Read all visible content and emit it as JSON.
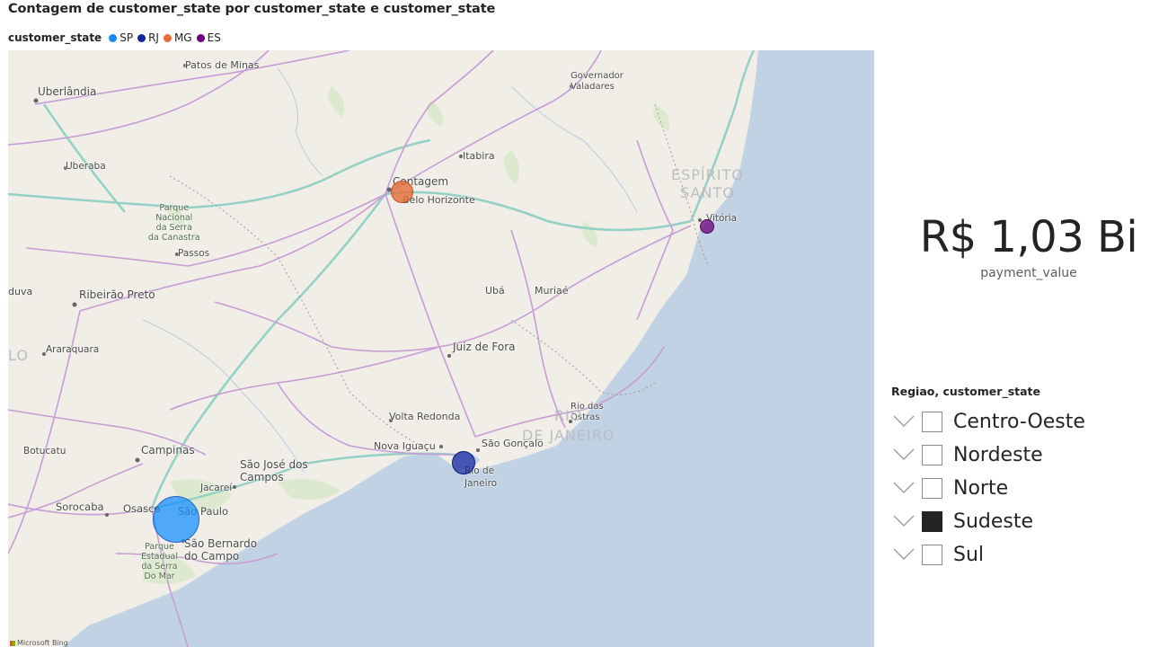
{
  "map_visual": {
    "title": "Contagem de customer_state por customer_state e customer_state",
    "legend": {
      "title": "customer_state",
      "items": [
        {
          "label": "SP",
          "color": "#118dff"
        },
        {
          "label": "RJ",
          "color": "#12239e"
        },
        {
          "label": "MG",
          "color": "#e66c37"
        },
        {
          "label": "ES",
          "color": "#6b007b"
        }
      ]
    },
    "bubbles": [
      {
        "state": "SP",
        "color": "#118dff"
      },
      {
        "state": "RJ",
        "color": "#12239e"
      },
      {
        "state": "MG",
        "color": "#e66c37"
      },
      {
        "state": "ES",
        "color": "#6b007b"
      }
    ],
    "place_labels": {
      "patos_de_minas": "Patos de Minas",
      "uberlandia": "Uberlândia",
      "governador_valadares": "Governador\nValadares",
      "itabira": "Itabira",
      "uberaba": "Uberaba",
      "contagem": "Contagem",
      "belo_horizonte": "Belo Horizonte",
      "espirito_santo": "ESPÍRITO\nSANTO",
      "vitoria": "Vitória",
      "parque_canastra": "Parque\nNacional\nda Serra\nda Canastra",
      "passos": "Passos",
      "duva": "duva",
      "ribeirao_preto": "Ribeirão Preto",
      "uba": "Ubá",
      "muriae": "Muriaé",
      "araraquara": "Araraquara",
      "lo": "LO",
      "juiz_de_fora": "Juiz de Fora",
      "rio_das_ostras": "Rio das\nOstras",
      "rio_de_janeiro_state": "RIO\nDE JANEIRO",
      "volta_redonda": "Volta Redonda",
      "botucatu": "Botucatu",
      "campinas": "Campinas",
      "nova_iguacu": "Nova Iguaçu",
      "sao_goncalo": "São Gonçalo",
      "sao_jose_dos_campos": "São José dos\nCampos",
      "rio_de_janeiro": "Rio de\nJaneiro",
      "jacarei": "Jacareí",
      "sorocaba": "Sorocaba",
      "osasco": "Osasco",
      "sao_paulo": "São Paulo",
      "sao_bernardo": "São Bernardo\ndo Campo",
      "parque_serra_mar": "Parque\nEstadual\nda Serra\nDo Mar"
    },
    "attribution": "Microsoft Bing"
  },
  "card": {
    "value": "R$ 1,03 Bi",
    "label": "payment_value"
  },
  "slicer": {
    "title": "Regiao, customer_state",
    "items": [
      {
        "label": "Centro-Oeste",
        "checked": false
      },
      {
        "label": "Nordeste",
        "checked": false
      },
      {
        "label": "Norte",
        "checked": false
      },
      {
        "label": "Sudeste",
        "checked": true
      },
      {
        "label": "Sul",
        "checked": false
      }
    ]
  }
}
